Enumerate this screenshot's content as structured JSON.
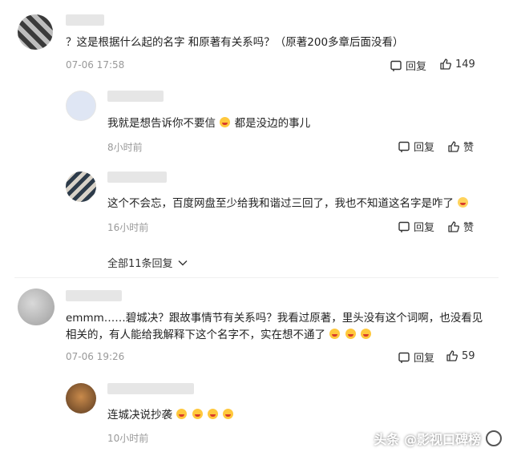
{
  "comments": [
    {
      "text": "？这是根据什么起的名字 和原著有关系吗？（原著200多章后面没看）",
      "time": "07-06 17:58",
      "reply_label": "回复",
      "like_label": "149"
    },
    {
      "text_before": "我就是想告诉你不要信",
      "text_after": "都是没边的事儿",
      "time": "8小时前",
      "reply_label": "回复",
      "like_label": "赞"
    },
    {
      "text": "这个不会忘，百度网盘至少给我和谐过三回了，我也不知道这名字是咋了",
      "time": "16小时前",
      "reply_label": "回复",
      "like_label": "赞"
    },
    {
      "line1": "emmm……碧城决？跟故事情节有关系吗？我看过原著，里头没有这个词啊，也没看见",
      "line2": "相关的，有人能给我解释下这个名字不，实在想不通了",
      "time": "07-06 19:26",
      "reply_label": "回复",
      "like_label": "59"
    },
    {
      "text": "连城决说抄袭",
      "time": "10小时前"
    }
  ],
  "expand_replies": "全部11条回复",
  "watermark": "头条 @影视口碑榜",
  "colors": {
    "meta": "#999999",
    "text": "#222222",
    "emoji": "#ffc83d"
  }
}
